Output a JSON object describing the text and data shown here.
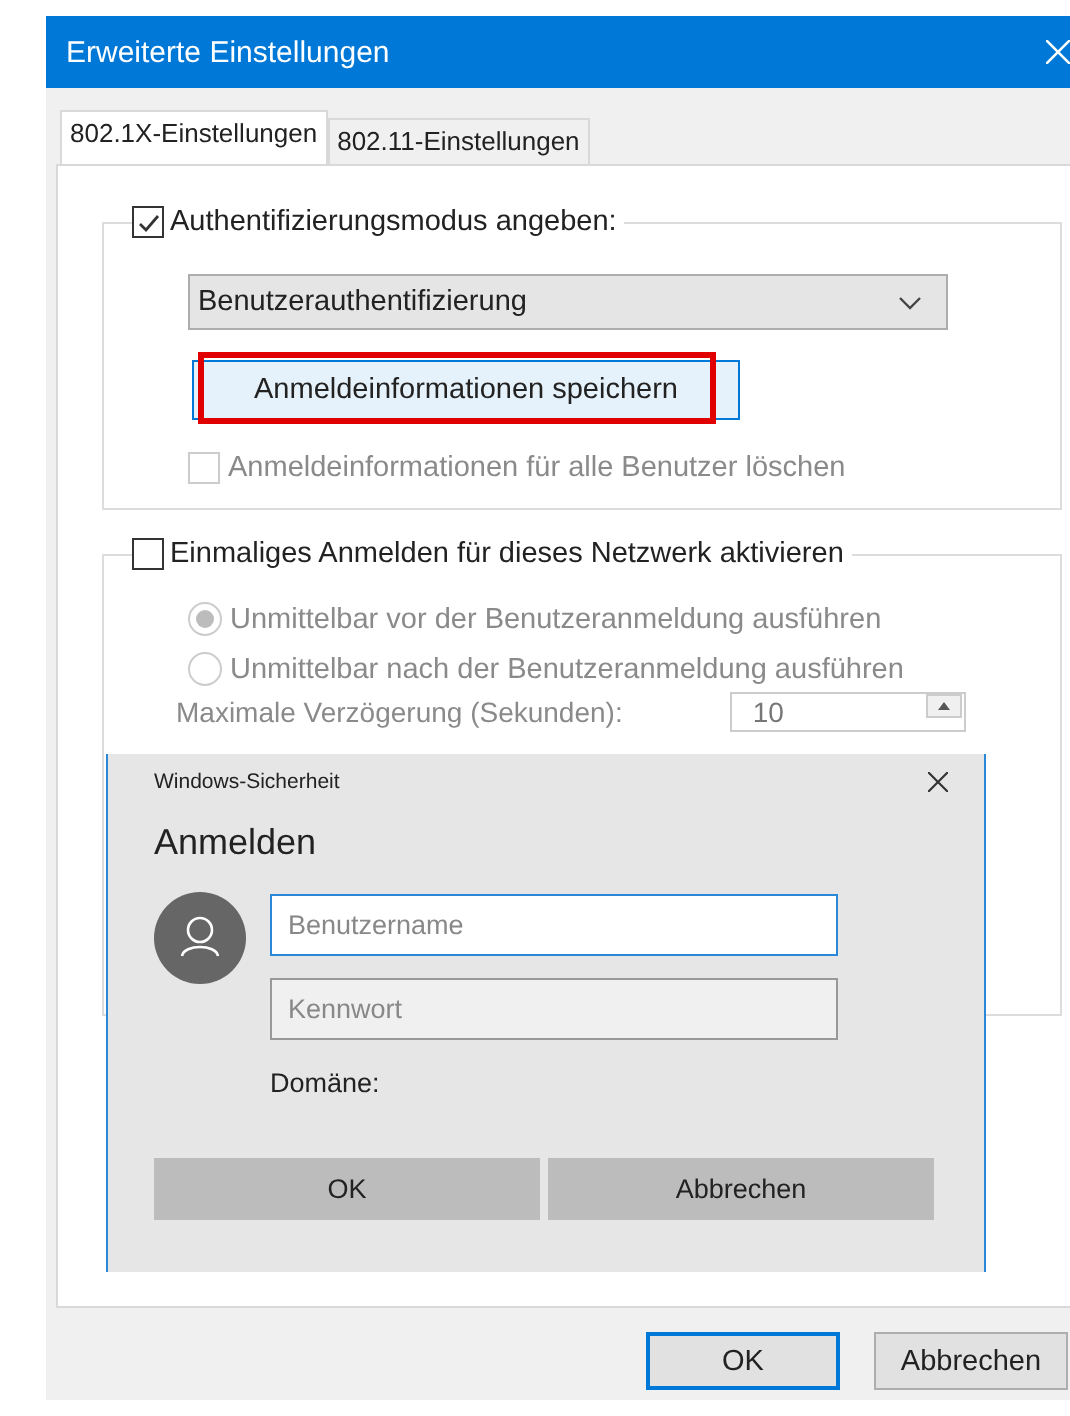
{
  "window": {
    "title": "Erweiterte Einstellungen"
  },
  "tabs": [
    {
      "label": "802.1X-Einstellungen",
      "selected": true
    },
    {
      "label": "802.11-Einstellungen",
      "selected": false
    }
  ],
  "auth_group": {
    "checkbox": {
      "label": "Authentifizierungsmodus angeben:",
      "checked": true
    },
    "mode_dropdown": {
      "value": "Benutzerauthentifizierung"
    },
    "save_button": {
      "label": "Anmeldeinformationen speichern",
      "highlighted": true
    },
    "delete_checkbox": {
      "label": "Anmeldeinformationen für alle Benutzer löschen",
      "checked": false,
      "disabled": true
    }
  },
  "sso_group": {
    "checkbox": {
      "label": "Einmaliges Anmelden für dieses Netzwerk aktivieren",
      "checked": false
    },
    "radios": [
      {
        "label": "Unmittelbar vor der Benutzeranmeldung ausführen",
        "selected": true,
        "disabled": true
      },
      {
        "label": "Unmittelbar nach der Benutzeranmeldung ausführen",
        "selected": false,
        "disabled": true
      }
    ],
    "delay_label": "Maximale Verzögerung (Sekunden):",
    "delay_value": "10"
  },
  "dialog": {
    "title": "Windows-Sicherheit",
    "heading": "Anmelden",
    "username": {
      "placeholder": "Benutzername"
    },
    "password": {
      "placeholder": "Kennwort"
    },
    "domain_label": "Domäne:",
    "buttons": [
      "OK",
      "Abbrechen"
    ]
  },
  "footer_buttons": [
    {
      "label": "OK",
      "default": true
    },
    {
      "label": "Abbrechen",
      "default": false
    }
  ]
}
